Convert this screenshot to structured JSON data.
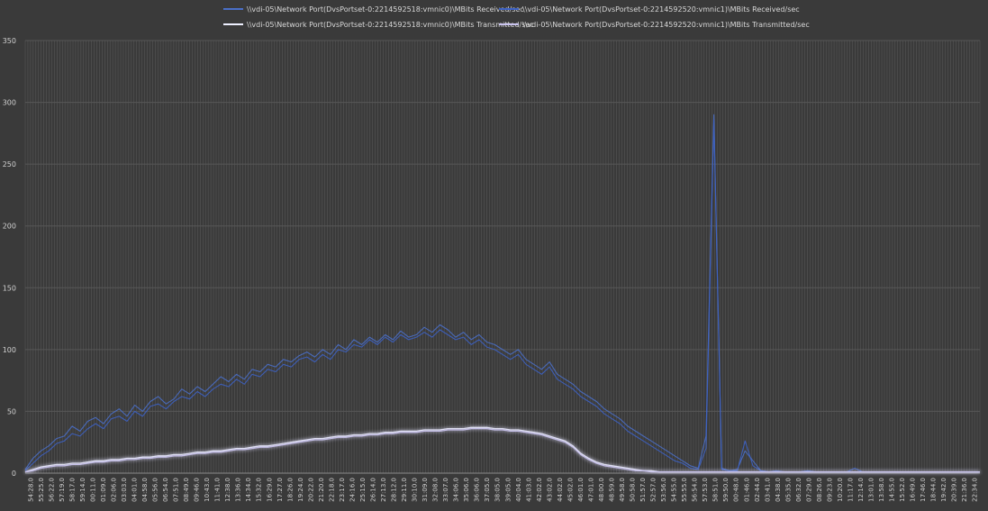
{
  "chart_data": {
    "type": "line",
    "title": "",
    "xlabel": "",
    "ylabel": "",
    "ylim": [
      0,
      350
    ],
    "yticks": [
      0,
      50,
      100,
      150,
      200,
      250,
      300,
      350
    ],
    "grid": {
      "horizontal": true,
      "vertical": true
    },
    "legend_position": "top",
    "colors": {
      "background": "#3a3a3a",
      "grid": "#575757",
      "tick_text": "#d0d0d0",
      "legend_text": "#d8d8d8"
    },
    "x_tick_labels": [
      "54:28.0",
      "55:25.0",
      "56:22.0",
      "57:19.0",
      "58:17.0",
      "59:14.0",
      "00:11.0",
      "01:09.0",
      "02:06.0",
      "03:03.0",
      "04:01.0",
      "04:58.0",
      "05:56.0",
      "06:54.0",
      "07:51.0",
      "08:49.0",
      "09:46.0",
      "10:43.0",
      "11:41.0",
      "12:38.0",
      "13:36.0",
      "14:34.0",
      "15:32.0",
      "16:29.0",
      "17:27.0",
      "18:26.0",
      "19:24.0",
      "20:22.0",
      "21:20.0",
      "22:18.0",
      "23:17.0",
      "24:16.0",
      "25:15.0",
      "26:14.0",
      "27:13.0",
      "28:12.0",
      "29:11.0",
      "30:10.0",
      "31:09.0",
      "32:08.0",
      "33:07.0",
      "34:06.0",
      "35:06.0",
      "36:06.0",
      "37:05.0",
      "38:05.0",
      "39:05.0",
      "40:04.0",
      "41:03.0",
      "42:02.0",
      "43:02.0",
      "44:02.0",
      "45:02.0",
      "46:01.0",
      "47:01.0",
      "48:00.0",
      "48:59.0",
      "49:58.0",
      "50:58.0",
      "51:57.0",
      "52:57.0",
      "53:56.0",
      "54:55.0",
      "55:55.0",
      "56:54.0",
      "57:53.0",
      "58:51.0",
      "59:50.0",
      "00:48.0",
      "01:46.0",
      "02:44.0",
      "03:41.0",
      "04:38.0",
      "05:35.0",
      "06:32.0",
      "07:29.0",
      "08:26.0",
      "09:23.0",
      "10:20.0",
      "11:17.0",
      "12:14.0",
      "13:01.0",
      "13:58.0",
      "14:55.0",
      "15:52.0",
      "16:49.0",
      "17:46.0",
      "18:44.0",
      "19:42.0",
      "20:39.0",
      "21:36.0",
      "22:34.0"
    ],
    "series": [
      {
        "name": "\\\\vdi-05\\Network Port(DvsPortset-0:2214592518:vmnic0)\\MBits Received/sec",
        "color": "#4a6fc8",
        "values": [
          3,
          12,
          18,
          22,
          28,
          30,
          38,
          34,
          42,
          45,
          40,
          48,
          52,
          46,
          55,
          50,
          58,
          62,
          56,
          60,
          68,
          64,
          70,
          66,
          72,
          78,
          74,
          80,
          76,
          84,
          82,
          88,
          86,
          92,
          90,
          95,
          98,
          94,
          100,
          96,
          104,
          100,
          108,
          104,
          110,
          106,
          112,
          108,
          115,
          110,
          112,
          118,
          114,
          120,
          116,
          110,
          114,
          108,
          112,
          106,
          104,
          100,
          96,
          100,
          92,
          88,
          84,
          90,
          80,
          76,
          72,
          66,
          62,
          58,
          52,
          48,
          44,
          38,
          34,
          30,
          26,
          22,
          18,
          14,
          10,
          6,
          4,
          30,
          290,
          4,
          2,
          3,
          18,
          10,
          2,
          1,
          2,
          1,
          1,
          1,
          2,
          1,
          1,
          1,
          1,
          1,
          1,
          1,
          1,
          1,
          1,
          1,
          1,
          1,
          1,
          1,
          1,
          1,
          1,
          1,
          1,
          1,
          1
        ]
      },
      {
        "name": "\\\\vdi-05\\Network Port(DvsPortset-0:2214592520:vmnic1)\\MBits Received/sec",
        "color": "#3d62c4",
        "values": [
          2,
          8,
          14,
          18,
          24,
          26,
          32,
          30,
          36,
          40,
          36,
          44,
          46,
          42,
          50,
          46,
          54,
          56,
          52,
          58,
          62,
          60,
          66,
          62,
          68,
          72,
          70,
          76,
          72,
          80,
          78,
          84,
          82,
          88,
          86,
          92,
          94,
          90,
          96,
          92,
          100,
          98,
          104,
          102,
          108,
          104,
          110,
          106,
          112,
          108,
          110,
          114,
          110,
          116,
          112,
          108,
          110,
          104,
          108,
          102,
          100,
          96,
          92,
          96,
          88,
          84,
          80,
          86,
          76,
          72,
          68,
          62,
          58,
          54,
          48,
          44,
          40,
          34,
          30,
          26,
          22,
          18,
          14,
          10,
          8,
          4,
          3,
          20,
          286,
          3,
          2,
          2,
          26,
          6,
          2,
          1,
          1,
          1,
          1,
          1,
          1,
          1,
          1,
          1,
          1,
          1,
          4,
          1,
          1,
          1,
          1,
          1,
          1,
          1,
          1,
          1,
          1,
          1,
          1,
          1,
          1,
          1,
          1
        ]
      },
      {
        "name": "\\\\vdi-05\\Network Port(DvsPortset-0:2214592518:vmnic0)\\MBits Transmitted/sec",
        "color": "#eef0ff",
        "values": [
          1,
          3,
          5,
          6,
          7,
          7,
          8,
          8,
          9,
          10,
          10,
          11,
          11,
          12,
          12,
          13,
          13,
          14,
          14,
          15,
          15,
          16,
          17,
          17,
          18,
          18,
          19,
          20,
          20,
          21,
          22,
          22,
          23,
          24,
          25,
          26,
          27,
          28,
          28,
          29,
          30,
          30,
          31,
          31,
          32,
          32,
          33,
          33,
          34,
          34,
          34,
          35,
          35,
          35,
          36,
          36,
          36,
          37,
          37,
          37,
          36,
          36,
          35,
          35,
          34,
          33,
          32,
          30,
          28,
          26,
          22,
          16,
          12,
          9,
          7,
          6,
          5,
          4,
          3,
          2,
          2,
          1,
          1,
          1,
          1,
          1,
          1,
          1,
          1,
          1,
          1,
          1,
          1,
          1,
          1,
          1,
          1,
          1,
          1,
          1,
          1,
          1,
          1,
          1,
          1,
          1,
          1,
          1,
          1,
          1,
          1,
          1,
          1,
          1,
          1,
          1,
          1,
          1,
          1,
          1,
          1,
          1,
          1
        ]
      },
      {
        "name": "\\\\vdi-05\\Network Port(DvsPortset-0:2214592520:vmnic1)\\MBits Transmitted/sec",
        "color": "#c9c3ee",
        "values": [
          1,
          2,
          4,
          5,
          6,
          6,
          7,
          7,
          8,
          9,
          9,
          10,
          10,
          11,
          11,
          12,
          12,
          13,
          13,
          14,
          14,
          15,
          16,
          16,
          17,
          17,
          18,
          19,
          19,
          20,
          21,
          21,
          22,
          23,
          24,
          25,
          26,
          27,
          27,
          28,
          29,
          29,
          30,
          30,
          31,
          31,
          32,
          32,
          33,
          33,
          33,
          34,
          34,
          34,
          35,
          35,
          35,
          36,
          36,
          36,
          35,
          35,
          34,
          34,
          33,
          32,
          31,
          29,
          27,
          25,
          21,
          15,
          11,
          8,
          6,
          5,
          4,
          3,
          2,
          2,
          1,
          1,
          1,
          1,
          1,
          1,
          1,
          1,
          1,
          1,
          1,
          1,
          1,
          1,
          1,
          1,
          1,
          1,
          1,
          1,
          1,
          1,
          1,
          1,
          1,
          1,
          1,
          1,
          1,
          1,
          1,
          1,
          1,
          1,
          1,
          1,
          1,
          1,
          1,
          1,
          1,
          1,
          1
        ]
      }
    ]
  }
}
